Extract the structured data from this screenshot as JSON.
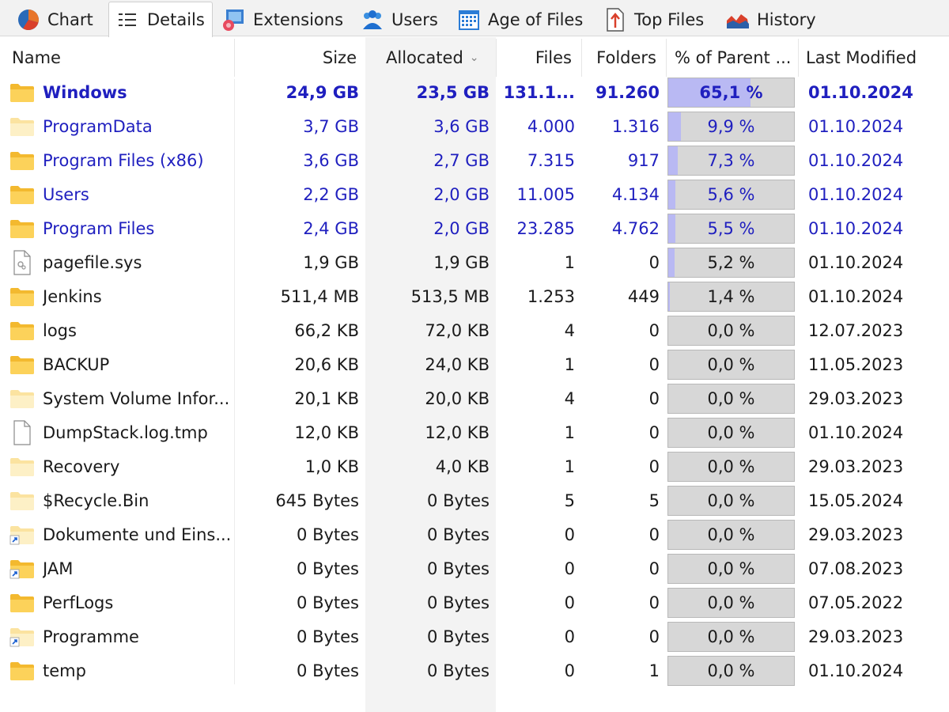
{
  "tabs": [
    {
      "label": "Chart",
      "icon": "pie-chart-icon",
      "active": false
    },
    {
      "label": "Details",
      "icon": "details-list-icon",
      "active": true
    },
    {
      "label": "Extensions",
      "icon": "extensions-icon",
      "active": false
    },
    {
      "label": "Users",
      "icon": "users-icon",
      "active": false
    },
    {
      "label": "Age of Files",
      "icon": "calendar-icon",
      "active": false
    },
    {
      "label": "Top Files",
      "icon": "top-files-icon",
      "active": false
    },
    {
      "label": "History",
      "icon": "history-icon",
      "active": false
    }
  ],
  "columns": {
    "name": "Name",
    "size": "Size",
    "allocated": "Allocated",
    "files": "Files",
    "folders": "Folders",
    "pct_parent": "% of Parent ...",
    "last_modified": "Last Modified",
    "sorted_by": "allocated",
    "sort_arrow": "⌄"
  },
  "colors": {
    "link_blue": "#1f1fbf",
    "bar_fill": "#b9b9f3",
    "bar_track": "#d7d7d7",
    "folder_yellow": "#f8c545"
  },
  "rows": [
    {
      "name": "Windows",
      "type": "folder",
      "size": "24,9 GB",
      "allocated": "23,5 GB",
      "files": "131.1...",
      "folders": "91.260",
      "pct": "65,1 %",
      "pct_value": 65.1,
      "modified": "01.10.2024",
      "blue": true,
      "bold": true
    },
    {
      "name": "ProgramData",
      "type": "folder-light",
      "size": "3,7 GB",
      "allocated": "3,6 GB",
      "files": "4.000",
      "folders": "1.316",
      "pct": "9,9 %",
      "pct_value": 9.9,
      "modified": "01.10.2024",
      "blue": true,
      "bold": false
    },
    {
      "name": "Program Files (x86)",
      "type": "folder",
      "size": "3,6 GB",
      "allocated": "2,7 GB",
      "files": "7.315",
      "folders": "917",
      "pct": "7,3 %",
      "pct_value": 7.3,
      "modified": "01.10.2024",
      "blue": true,
      "bold": false
    },
    {
      "name": "Users",
      "type": "folder",
      "size": "2,2 GB",
      "allocated": "2,0 GB",
      "files": "11.005",
      "folders": "4.134",
      "pct": "5,6 %",
      "pct_value": 5.6,
      "modified": "01.10.2024",
      "blue": true,
      "bold": false
    },
    {
      "name": "Program Files",
      "type": "folder",
      "size": "2,4 GB",
      "allocated": "2,0 GB",
      "files": "23.285",
      "folders": "4.762",
      "pct": "5,5 %",
      "pct_value": 5.5,
      "modified": "01.10.2024",
      "blue": true,
      "bold": false
    },
    {
      "name": "pagefile.sys",
      "type": "system-file",
      "size": "1,9 GB",
      "allocated": "1,9 GB",
      "files": "1",
      "folders": "0",
      "pct": "5,2 %",
      "pct_value": 5.2,
      "modified": "01.10.2024",
      "blue": false,
      "bold": false
    },
    {
      "name": "Jenkins",
      "type": "folder",
      "size": "511,4 MB",
      "allocated": "513,5 MB",
      "files": "1.253",
      "folders": "449",
      "pct": "1,4 %",
      "pct_value": 1.4,
      "modified": "01.10.2024",
      "blue": false,
      "bold": false
    },
    {
      "name": "logs",
      "type": "folder",
      "size": "66,2 KB",
      "allocated": "72,0 KB",
      "files": "4",
      "folders": "0",
      "pct": "0,0 %",
      "pct_value": 0,
      "modified": "12.07.2023",
      "blue": false,
      "bold": false
    },
    {
      "name": "BACKUP",
      "type": "folder",
      "size": "20,6 KB",
      "allocated": "24,0 KB",
      "files": "1",
      "folders": "0",
      "pct": "0,0 %",
      "pct_value": 0,
      "modified": "11.05.2023",
      "blue": false,
      "bold": false
    },
    {
      "name": "System Volume Infor...",
      "type": "folder-light",
      "size": "20,1 KB",
      "allocated": "20,0 KB",
      "files": "4",
      "folders": "0",
      "pct": "0,0 %",
      "pct_value": 0,
      "modified": "29.03.2023",
      "blue": false,
      "bold": false
    },
    {
      "name": "DumpStack.log.tmp",
      "type": "file",
      "size": "12,0 KB",
      "allocated": "12,0 KB",
      "files": "1",
      "folders": "0",
      "pct": "0,0 %",
      "pct_value": 0,
      "modified": "01.10.2024",
      "blue": false,
      "bold": false
    },
    {
      "name": "Recovery",
      "type": "folder-light",
      "size": "1,0 KB",
      "allocated": "4,0 KB",
      "files": "1",
      "folders": "0",
      "pct": "0,0 %",
      "pct_value": 0,
      "modified": "29.03.2023",
      "blue": false,
      "bold": false
    },
    {
      "name": "$Recycle.Bin",
      "type": "folder-light",
      "size": "645 Bytes",
      "allocated": "0 Bytes",
      "files": "5",
      "folders": "5",
      "pct": "0,0 %",
      "pct_value": 0,
      "modified": "15.05.2024",
      "blue": false,
      "bold": false
    },
    {
      "name": "Dokumente und Eins...",
      "type": "folder-link-light",
      "size": "0 Bytes",
      "allocated": "0 Bytes",
      "files": "0",
      "folders": "0",
      "pct": "0,0 %",
      "pct_value": 0,
      "modified": "29.03.2023",
      "blue": false,
      "bold": false
    },
    {
      "name": "JAM",
      "type": "folder-link",
      "size": "0 Bytes",
      "allocated": "0 Bytes",
      "files": "0",
      "folders": "0",
      "pct": "0,0 %",
      "pct_value": 0,
      "modified": "07.08.2023",
      "blue": false,
      "bold": false
    },
    {
      "name": "PerfLogs",
      "type": "folder",
      "size": "0 Bytes",
      "allocated": "0 Bytes",
      "files": "0",
      "folders": "0",
      "pct": "0,0 %",
      "pct_value": 0,
      "modified": "07.05.2022",
      "blue": false,
      "bold": false
    },
    {
      "name": "Programme",
      "type": "folder-link-light",
      "size": "0 Bytes",
      "allocated": "0 Bytes",
      "files": "0",
      "folders": "0",
      "pct": "0,0 %",
      "pct_value": 0,
      "modified": "29.03.2023",
      "blue": false,
      "bold": false
    },
    {
      "name": "temp",
      "type": "folder",
      "size": "0 Bytes",
      "allocated": "0 Bytes",
      "files": "0",
      "folders": "1",
      "pct": "0,0 %",
      "pct_value": 0,
      "modified": "01.10.2024",
      "blue": false,
      "bold": false
    }
  ]
}
